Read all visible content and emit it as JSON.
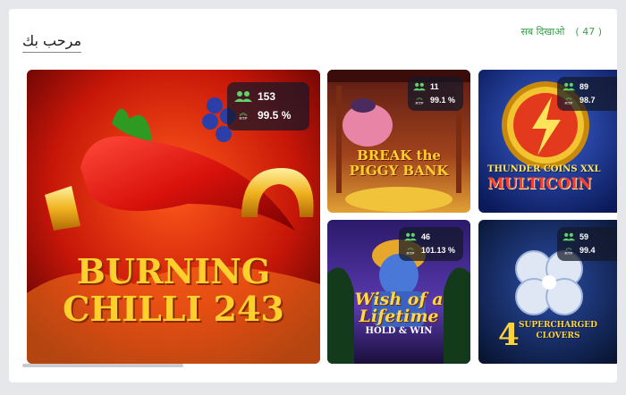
{
  "section": {
    "title": "مرحب بك",
    "show_all_label": "सब दिखाओ",
    "show_all_count": "( 47 )"
  },
  "games": [
    {
      "name": "BURNING CHILLI 243",
      "title_lines": [
        "BURNING",
        "CHILLI 243"
      ],
      "players": "153",
      "rtp": "99.5 %",
      "rtp_label": "RTP"
    },
    {
      "name": "BREAK the PIGGY BANK",
      "title_lines": [
        "BREAK the",
        "PIGGY BANK"
      ],
      "players": "11",
      "rtp": "99.1 %",
      "rtp_label": "RTP"
    },
    {
      "name": "THUNDER COINS XXL MULTICOIN",
      "title_lines": [
        "THUNDER COINS XXL",
        "MULTICOIN"
      ],
      "players": "89",
      "rtp": "98.7",
      "rtp_label": "RTP"
    },
    {
      "name": "Wish of a Lifetime HOLD & WIN",
      "title_lines": [
        "Wish of a",
        "Lifetime",
        "HOLD & WIN"
      ],
      "players": "46",
      "rtp": "101.13 %",
      "rtp_label": "RTP"
    },
    {
      "name": "4 SUPERCHARGED CLOVERS",
      "title_lines": [
        "SUPERCHARGED",
        "CLOVERS"
      ],
      "players": "59",
      "rtp": "99.4",
      "rtp_label": "RTP"
    }
  ],
  "colors": {
    "accent": "#3aa14b",
    "badge_bg": "#141828"
  }
}
